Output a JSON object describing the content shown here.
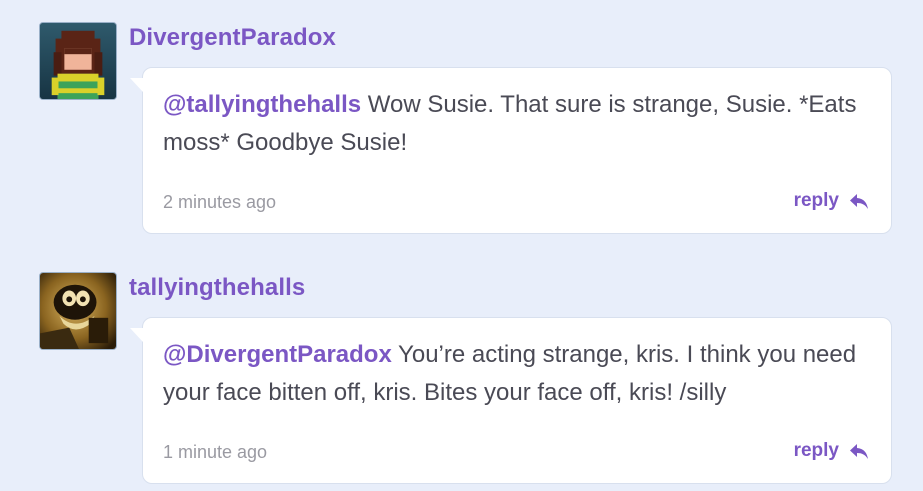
{
  "colors": {
    "background": "#e8eefa",
    "accent": "#7b57c4",
    "body_text": "#4a4a55",
    "muted_text": "#9a9aa2",
    "card": "#ffffff"
  },
  "comments": [
    {
      "username": "DivergentParadox",
      "avatar_icon": "pixel-character-avatar",
      "mention": "@tallyingthehalls",
      "body": " Wow Susie. That sure is strange, Susie. *Eats moss* Goodbye Susie!",
      "timestamp": "2 minutes ago",
      "reply_label": "reply",
      "reply_icon": "reply-arrow-icon"
    },
    {
      "username": "tallyingthehalls",
      "avatar_icon": "sepia-cartoon-avatar",
      "mention": "@DivergentParadox",
      "body": " You’re acting strange, kris. I think you need your face bitten off, kris. Bites your face off, kris! /silly",
      "timestamp": "1 minute ago",
      "reply_label": "reply",
      "reply_icon": "reply-arrow-icon"
    }
  ]
}
